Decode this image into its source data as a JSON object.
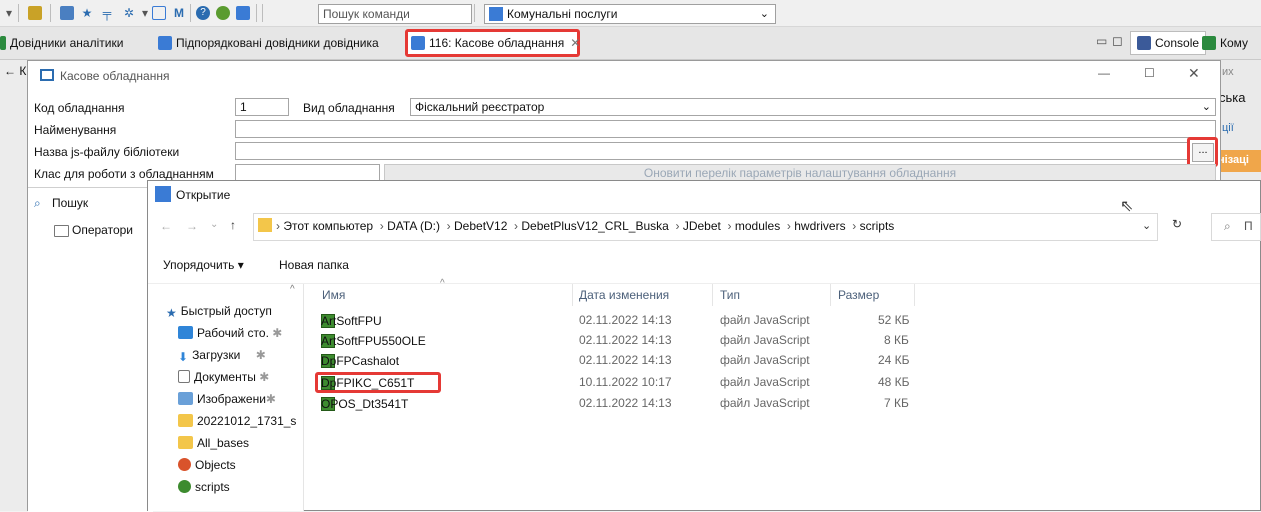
{
  "toolbar": {
    "command_search_placeholder": "Пошук команди",
    "document_combo_value": "Комунальні послуги"
  },
  "tabs": [
    {
      "label": "Довідники аналітики"
    },
    {
      "label": "Підпорядковані довідники довідника"
    },
    {
      "label": "116: Касове обладнання",
      "active": true
    }
  ],
  "right_tabs": {
    "console": "Console",
    "truncated": "Кому"
  },
  "window": {
    "title": "Касове обладнання",
    "left_truncated": "К"
  },
  "form": {
    "code_label": "Код обладнання",
    "code_value": "1",
    "type_label": "Вид обладнання",
    "type_value": "Фіскальний реєстратор",
    "name_label": "Найменування",
    "name_value": "",
    "js_file_label": "Назва js-файлу бібліотеки",
    "js_file_value": "",
    "browse_button": "...",
    "class_label": "Клас для роботи з обладнанням",
    "refresh_button": "Оновити перелік параметрів налаштування обладнання"
  },
  "right_panel": {
    "item1": "их",
    "item2": "ська",
    "item3": "ції",
    "item4": "нізаці"
  },
  "left_panel": {
    "search_label": "Пошук",
    "tree_item": "Оператори"
  },
  "dialog": {
    "title": "Открытие",
    "path": [
      "Этот компьютер",
      "DATA (D:)",
      "DebetV12",
      "DebetPlusV12_CRL_Buska",
      "JDebet",
      "modules",
      "hwdrivers",
      "scripts"
    ],
    "search_placeholder": "П",
    "organize_label": "Упорядочить ▾",
    "new_folder_label": "Новая папка",
    "nav": [
      {
        "label": "Быстрый доступ",
        "icon": "star-icon"
      },
      {
        "label": "Рабочий сто.",
        "icon": "desktop-icon"
      },
      {
        "label": "Загрузки",
        "icon": "download-icon"
      },
      {
        "label": "Документы",
        "icon": "documents-icon"
      },
      {
        "label": "Изображени",
        "icon": "pictures-icon"
      },
      {
        "label": "20221012_1731_s",
        "icon": "folder-icon"
      },
      {
        "label": "All_bases",
        "icon": "folder-icon"
      },
      {
        "label": "Objects",
        "icon": "office-icon"
      },
      {
        "label": "scripts",
        "icon": "js-folder-icon"
      }
    ],
    "columns": {
      "name": "Имя",
      "date": "Дата изменения",
      "type": "Тип",
      "size": "Размер"
    },
    "files": [
      {
        "name": "ArtSoftFPU",
        "date": "02.11.2022 14:13",
        "type": "файл JavaScript",
        "size": "52 КБ"
      },
      {
        "name": "ArtSoftFPU550OLE",
        "date": "02.11.2022 14:13",
        "type": "файл JavaScript",
        "size": "8 КБ"
      },
      {
        "name": "DpFPCashalot",
        "date": "02.11.2022 14:13",
        "type": "файл JavaScript",
        "size": "24 КБ"
      },
      {
        "name": "DpFPIKC_C651T",
        "date": "10.11.2022 10:17",
        "type": "файл JavaScript",
        "size": "48 КБ"
      },
      {
        "name": "OPOS_Dt3541T",
        "date": "02.11.2022 14:13",
        "type": "файл JavaScript",
        "size": "7 КБ"
      }
    ]
  },
  "colors": {
    "highlight": "#e53935",
    "accent": "#3a7bd5"
  }
}
